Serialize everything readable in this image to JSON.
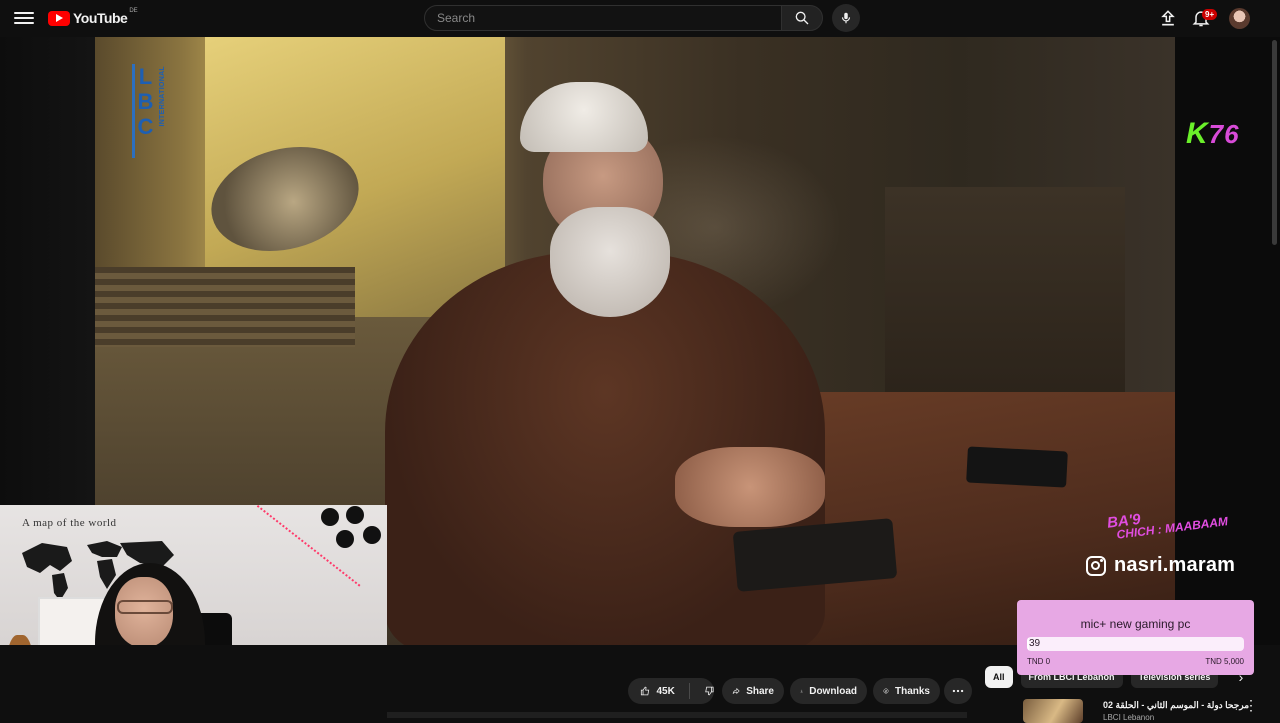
{
  "header": {
    "logo_text": "YouTube",
    "region": "DE",
    "search_placeholder": "Search",
    "notification_count": "9+",
    "icons": [
      "menu-icon",
      "search-icon",
      "mic-icon",
      "upload-icon",
      "bell-icon",
      "avatar"
    ]
  },
  "video": {
    "channel_logo": "LBC",
    "channel_logo_sub": "INTERNATIONAL",
    "overlay_k76_k": "K",
    "overlay_k76_n": "76",
    "overlay_tag_line1": "BA'9",
    "overlay_tag_line2": "CHICH : MAABAAM",
    "instagram_handle": "nasri.maram",
    "colors": {
      "k": "#6af02a",
      "pink": "#d84bd8"
    }
  },
  "webcam": {
    "poster_title": "A map of the world"
  },
  "goal": {
    "title": "mic+ new gaming pc",
    "value": "39",
    "min_label": "TND 0",
    "max_label": "TND 5,000",
    "progress_fraction": 0.0078
  },
  "actions": {
    "like_count": "45K",
    "share_label": "Share",
    "download_label": "Download",
    "thanks_label": "Thanks"
  },
  "related": {
    "chips": [
      "All",
      "From LBCI Lebanon",
      "Television series"
    ],
    "recommendation_title": "مرجحا دولة - الموسم الثاني - الحلقة 02",
    "recommendation_channel": "LBCI Lebanon"
  }
}
